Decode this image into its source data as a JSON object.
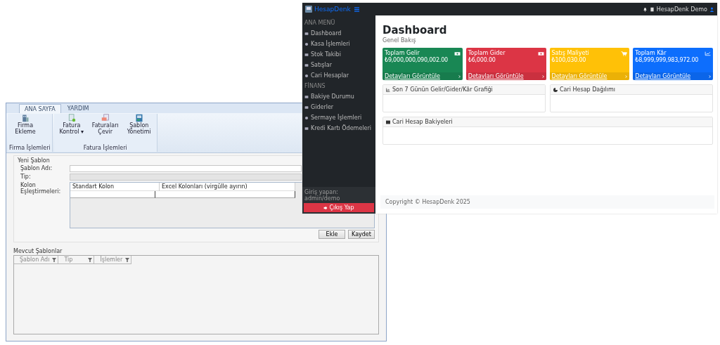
{
  "left_window": {
    "tabs": [
      {
        "label": "ANA SAYFA",
        "selected": true
      },
      {
        "label": "YARDIM",
        "selected": false
      }
    ],
    "ribbon_groups": [
      {
        "label": "Firma İşlemleri",
        "buttons": [
          {
            "label": "Firma Ekleme"
          }
        ]
      },
      {
        "label": "Fatura İşlemleri",
        "buttons": [
          {
            "label": "Fatura Kontrol ▾"
          },
          {
            "label": "Faturaları Çevir"
          },
          {
            "label": "Şablon Yönetimi"
          }
        ]
      }
    ],
    "new_template": {
      "title": "Yeni Şablon",
      "fields": [
        {
          "label": "Şablon Adı:",
          "kind": "text"
        },
        {
          "label": "Tip:",
          "kind": "combo"
        }
      ],
      "mapping_label": "Kolon Eşleştirmeleri:",
      "mapping_columns": [
        "Standart Kolon",
        "Excel Kolonları (virgülle ayırın)"
      ],
      "buttons": [
        "Ekle",
        "Kaydet"
      ]
    },
    "existing": {
      "title": "Mevcut Şablonlar",
      "columns": [
        "Şablon Adı",
        "Tip",
        "İşlemler"
      ]
    }
  },
  "right_window": {
    "brand": "HesapDenk",
    "topbar_user": "HesapDenk Demo",
    "sidebar_sections": [
      {
        "heading": "ANA MENÜ",
        "items": [
          {
            "label": "Dashboard"
          },
          {
            "label": "Kasa İşlemleri"
          },
          {
            "label": "Stok Takibi"
          },
          {
            "label": "Satışlar"
          },
          {
            "label": "Cari Hesaplar"
          }
        ]
      },
      {
        "heading": "FİNANS",
        "items": [
          {
            "label": "Bakiye Durumu"
          },
          {
            "label": "Giderler"
          },
          {
            "label": "Sermaye İşlemleri"
          },
          {
            "label": "Kredi Kartı Ödemeleri"
          }
        ]
      }
    ],
    "logged_in_label": "Giriş yapan:",
    "logged_in_user": "admin/demo",
    "logout": "Çıkış Yap",
    "page_title": "Dashboard",
    "page_subtitle": "Genel Bakış",
    "cards": [
      {
        "label": "Toplam Gelir",
        "value": "₺9,000,000,090,002.00",
        "link": "Detayları Görüntüle",
        "color": "#198754",
        "kind": "money"
      },
      {
        "label": "Toplam Gider",
        "value": "₺6,000.00",
        "link": "Detayları Görüntüle",
        "color": "#dc3545",
        "kind": "money"
      },
      {
        "label": "Satış Maliyeti",
        "value": "₺100,030.00",
        "link": "Detayları Görüntüle",
        "color": "#ffc107",
        "kind": "cart"
      },
      {
        "label": "Toplam Kâr",
        "value": "₺8,999,999,983,972.00",
        "link": "Detayları Görüntüle",
        "color": "#0d6efd",
        "kind": "chart"
      }
    ],
    "panels": [
      {
        "title": "Son 7 Günün Gelir/Gider/Kâr Grafiği",
        "kind": "chart",
        "wide": false
      },
      {
        "title": "Cari Hesap Dağılımı",
        "kind": "pie",
        "wide": false
      },
      {
        "title": "Cari Hesap Bakiyeleri",
        "kind": "table",
        "wide": true
      }
    ],
    "footer": "Copyright © HesapDenk 2025"
  }
}
